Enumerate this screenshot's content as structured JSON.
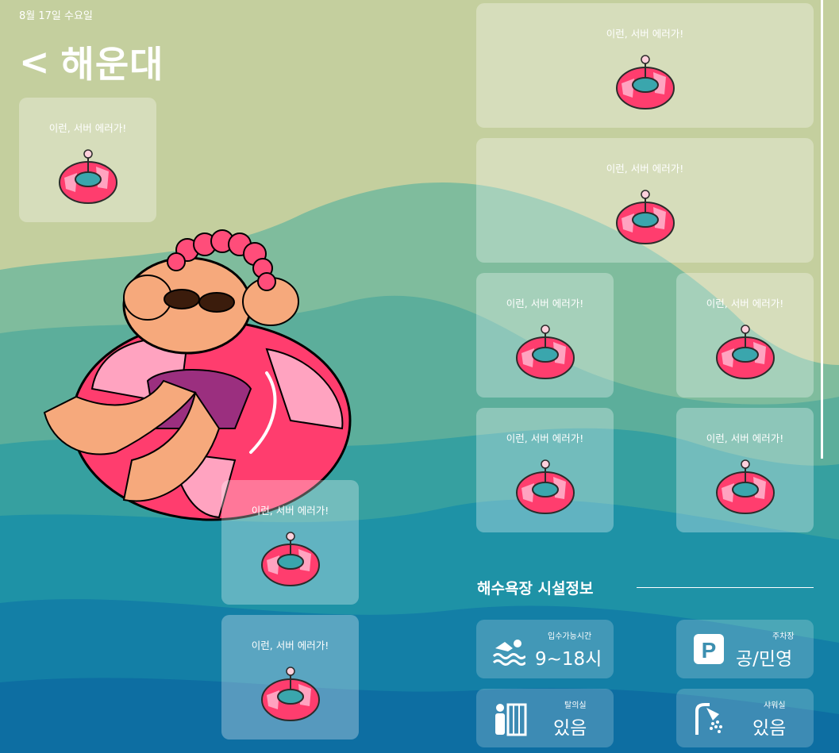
{
  "header": {
    "date": "8월 17일 수요일",
    "back_icon": "<",
    "beach_name": "해운대"
  },
  "error_cards": [
    {
      "message": "이런, 서버 에러가!",
      "icon": "swim-ring-icon"
    },
    {
      "message": "이런, 서버 에러가!",
      "icon": "swim-ring-icon"
    },
    {
      "message": "이런, 서버 에러가!",
      "icon": "swim-ring-icon"
    },
    {
      "message": "이런, 서버 에러가!",
      "icon": "swim-ring-icon"
    },
    {
      "message": "이런, 서버 에러가!",
      "icon": "swim-ring-icon"
    },
    {
      "message": "이런, 서버 에러가!",
      "icon": "swim-ring-icon"
    },
    {
      "message": "이런, 서버 에러가!",
      "icon": "swim-ring-icon"
    },
    {
      "message": "이런, 서버 에러가!",
      "icon": "swim-ring-icon"
    },
    {
      "message": "이런, 서버 에러가!",
      "icon": "swim-ring-icon"
    }
  ],
  "facilities": {
    "title": "해수욕장 시설정보",
    "items": [
      {
        "label": "입수가능시간",
        "value": "9~18시",
        "icon": "swimming-icon"
      },
      {
        "label": "주차장",
        "value": "공/민영",
        "icon": "parking-icon"
      },
      {
        "label": "탈의실",
        "value": "있음",
        "icon": "changing-room-icon"
      },
      {
        "label": "샤워실",
        "value": "있음",
        "icon": "shower-icon"
      }
    ]
  },
  "colors": {
    "sand": "#c4cf9e",
    "ring_pink": "#ff3d6e",
    "ring_light": "#ffa3c0",
    "sea_teal": "#4fa89c",
    "sea_blue": "#1a86a6"
  }
}
